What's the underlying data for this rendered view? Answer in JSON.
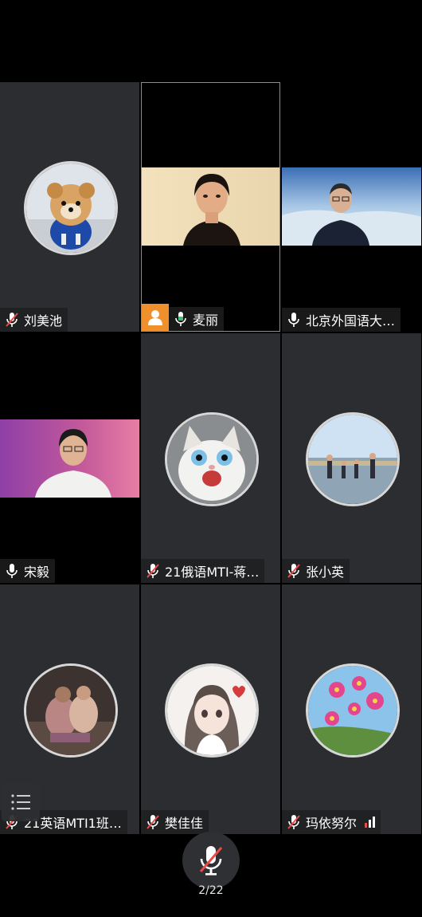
{
  "participants": [
    {
      "name": "刘美池",
      "mic": "muted",
      "type": "avatar",
      "avatar_icon": "pomeranian-dog"
    },
    {
      "name": "麦丽",
      "mic": "on",
      "type": "video",
      "host": true,
      "active": true
    },
    {
      "name": "北京外国语大…",
      "mic": "on",
      "type": "video"
    },
    {
      "name": "宋毅",
      "mic": "on",
      "type": "video"
    },
    {
      "name": "21俄语MTI-蒋…",
      "mic": "muted",
      "type": "avatar",
      "avatar_icon": "cat"
    },
    {
      "name": "张小英",
      "mic": "muted",
      "type": "avatar",
      "avatar_icon": "beach-family"
    },
    {
      "name": "21英语MTI1班…",
      "mic": "muted",
      "type": "avatar",
      "avatar_icon": "people-photo"
    },
    {
      "name": "樊佳佳",
      "mic": "muted",
      "type": "avatar",
      "avatar_icon": "anime-girl"
    },
    {
      "name": "玛依努尔",
      "mic": "muted",
      "type": "avatar",
      "avatar_icon": "cosmos-flowers",
      "signal": true
    }
  ],
  "page_indicator": "2/22",
  "colors": {
    "active_border": "#35c26a",
    "host_badge": "#f0902d",
    "muted": "#e94b4b"
  }
}
